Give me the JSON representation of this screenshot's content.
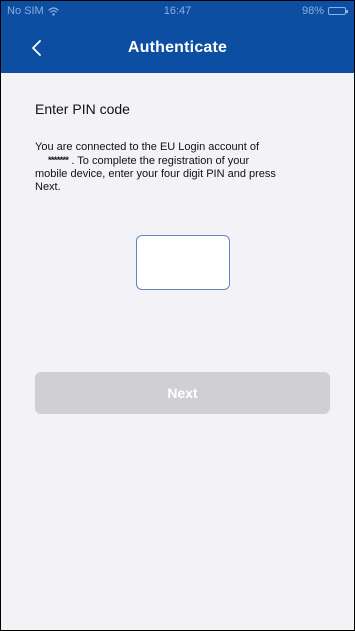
{
  "status_bar": {
    "carrier": "No SIM",
    "time": "16:47",
    "battery": "98%",
    "battery_level": 0.98,
    "wifi_icon": "wifi-icon",
    "battery_icon": "battery-icon"
  },
  "nav": {
    "title": "Authenticate",
    "back_icon": "chevron-left-icon"
  },
  "content": {
    "heading": "Enter PIN code",
    "instruction_lines": [
      "You are connected to the EU Login account of",
      "*******",
      ". To complete the registration of your",
      "mobile device, enter your four digit PIN and press",
      "Next."
    ],
    "pin_value": "",
    "pin_placeholder": "",
    "next_label": "Next"
  },
  "colors": {
    "header_background": "#0b4ea2",
    "screen_background": "#f2f2f7",
    "status_text": "#8fb0da",
    "pin_border": "#6187bd",
    "next_button_disabled": "#d0d0d4",
    "text_primary": "#111111",
    "header_text": "#ffffff"
  }
}
